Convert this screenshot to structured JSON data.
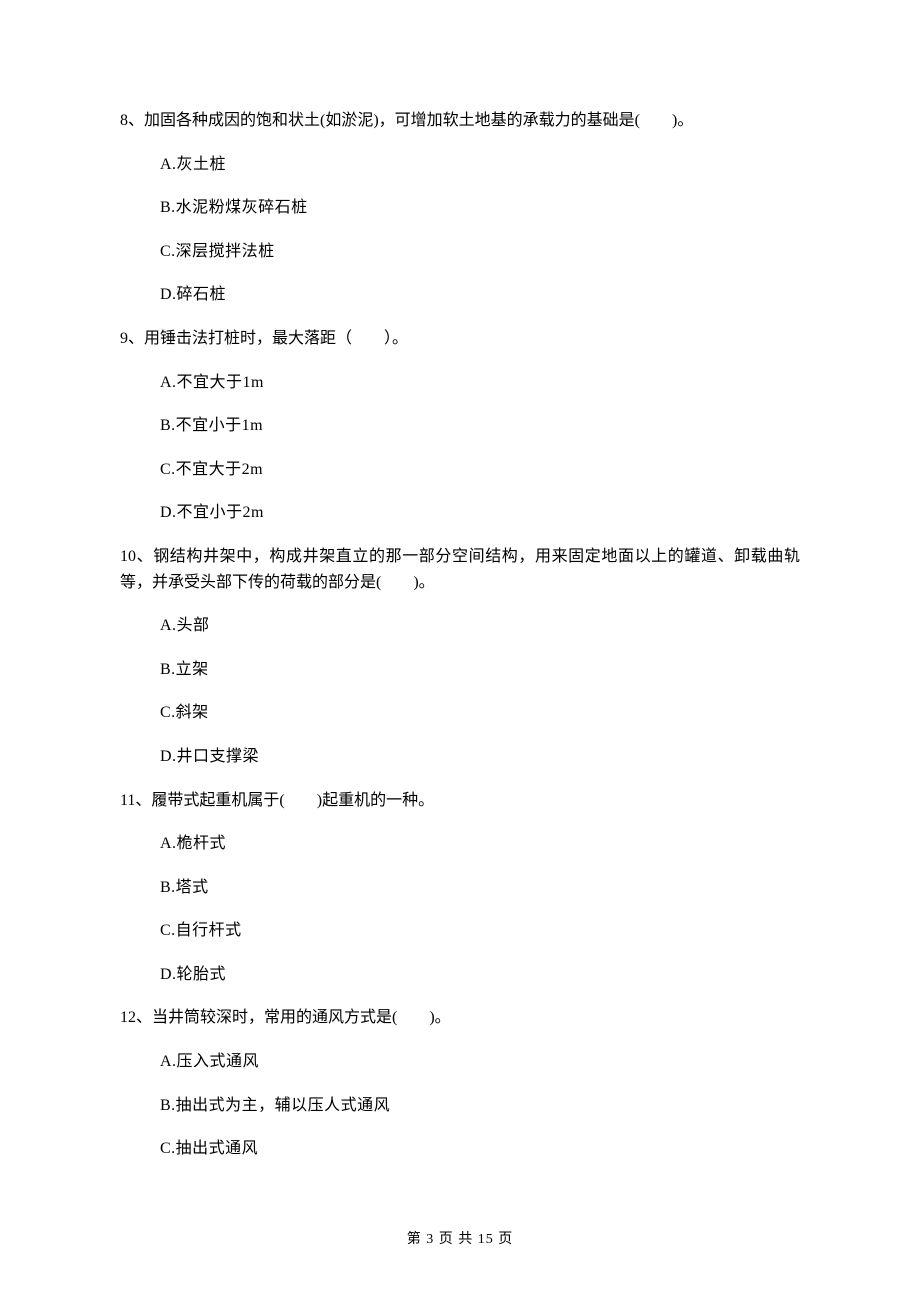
{
  "questions": [
    {
      "num": "8、",
      "text": "加固各种成因的饱和状土(如淤泥)，可增加软土地基的承载力的基础是(　　)。",
      "options": [
        "A.灰土桩",
        "B.水泥粉煤灰碎石桩",
        "C.深层搅拌法桩",
        "D.碎石桩"
      ]
    },
    {
      "num": "9、",
      "text": "用锤击法打桩时，最大落距（　　）。",
      "options": [
        "A.不宜大于1m",
        "B.不宜小于1m",
        "C.不宜大于2m",
        "D.不宜小于2m"
      ]
    },
    {
      "num": "10、",
      "text": "钢结构井架中，构成井架直立的那一部分空间结构，用来固定地面以上的罐道、卸载曲轨等，并承受头部下传的荷载的部分是(　　)。",
      "options": [
        "A.头部",
        "B.立架",
        "C.斜架",
        "D.井口支撑梁"
      ]
    },
    {
      "num": "11、",
      "text": "履带式起重机属于(　　)起重机的一种。",
      "options": [
        "A.桅杆式",
        "B.塔式",
        "C.自行杆式",
        "D.轮胎式"
      ]
    },
    {
      "num": "12、",
      "text": "当井筒较深时，常用的通风方式是(　　)。",
      "options": [
        "A.压入式通风",
        "B.抽出式为主，辅以压人式通风",
        "C.抽出式通风"
      ]
    }
  ],
  "footer": "第 3 页 共 15 页"
}
